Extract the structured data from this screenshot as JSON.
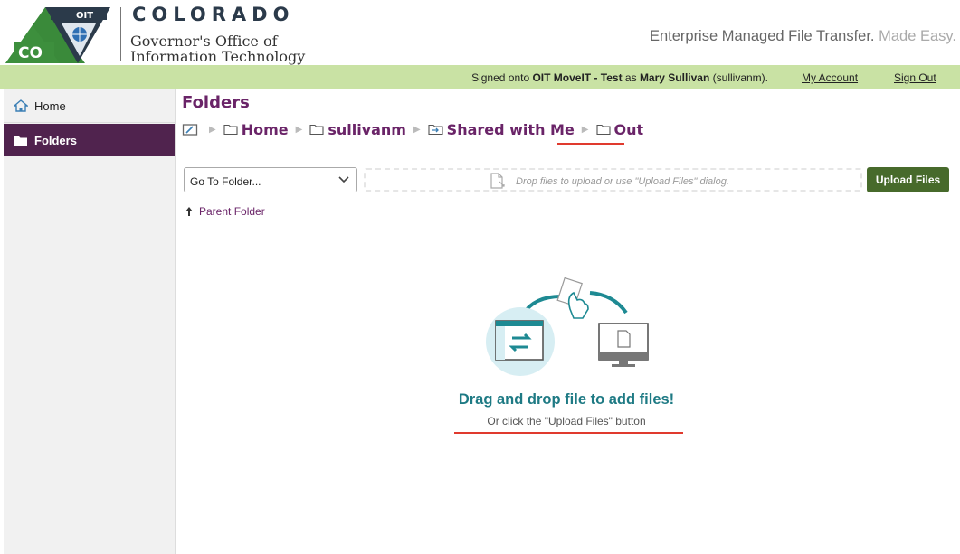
{
  "header": {
    "logo_text": "OIT",
    "logo_state": "CO",
    "brand_title": "COLORADO",
    "brand_sub_line1": "Governor's Office of",
    "brand_sub_line2": "Information Technology",
    "tagline_main": "Enterprise Managed File Transfer.",
    "tagline_fade": "Made Easy."
  },
  "statusbar": {
    "prefix": "Signed onto ",
    "system": "OIT MoveIT - Test",
    "middle": " as ",
    "user": "Mary Sullivan",
    "suffix": " (sullivanm).",
    "my_account": "My Account",
    "sign_out": "Sign Out"
  },
  "sidebar": {
    "items": [
      {
        "label": "Home",
        "icon": "home-icon"
      },
      {
        "label": "Folders",
        "icon": "folder-icon"
      }
    ]
  },
  "main": {
    "title": "Folders",
    "breadcrumb": [
      "Home",
      "sullivanm",
      "Shared with Me",
      "Out"
    ],
    "goto_label": "Go To Folder...",
    "dropzone_text": "Drop files to upload or use \"Upload Files\" dialog.",
    "upload_button": "Upload Files",
    "parent_folder": "Parent Folder",
    "dd_title": "Drag and drop file to add files!",
    "dd_subtitle": "Or click the \"Upload Files\" button"
  },
  "colors": {
    "accent_purple": "#6a2468",
    "status_green": "#c9e2a4",
    "button_green": "#476a2b",
    "teal": "#1e7a84",
    "annotation_red": "#e03a2e"
  }
}
